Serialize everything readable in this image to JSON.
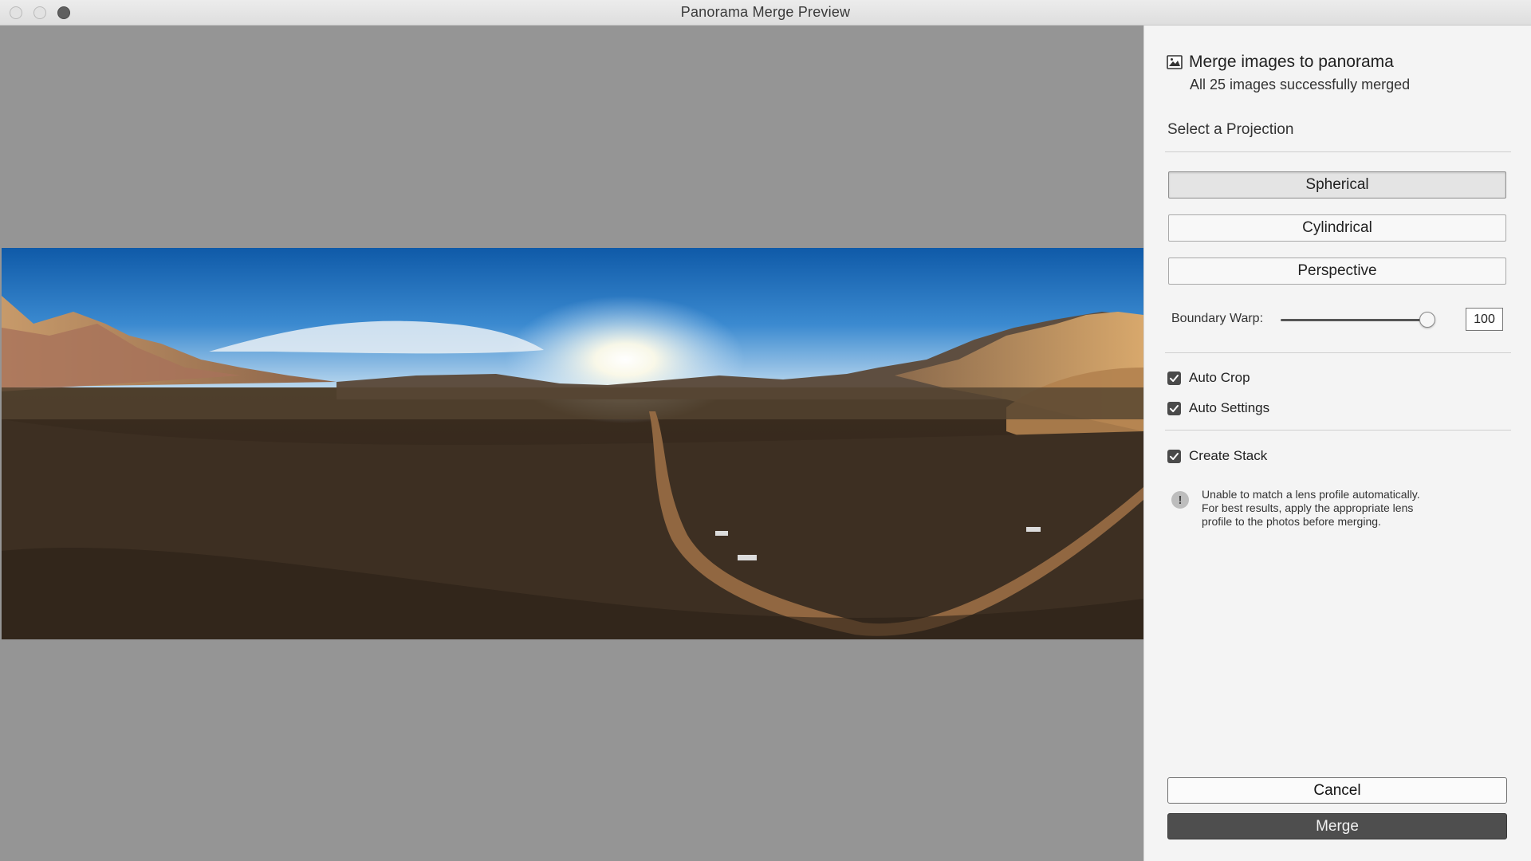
{
  "window": {
    "title": "Panorama Merge Preview"
  },
  "preview": {
    "background": "#959595"
  },
  "side": {
    "header_title": "Merge images to panorama",
    "header_subtitle": "All 25 images successfully merged",
    "projection_label": "Select a Projection",
    "projections": [
      {
        "label": "Spherical",
        "selected": true
      },
      {
        "label": "Cylindrical",
        "selected": false
      },
      {
        "label": "Perspective",
        "selected": false
      }
    ],
    "boundary_warp": {
      "label": "Boundary Warp:",
      "value": "100",
      "level": 1.0
    },
    "options": [
      {
        "label": "Auto Crop",
        "checked": true
      },
      {
        "label": "Auto Settings",
        "checked": true
      },
      {
        "label": "Create Stack",
        "checked": true
      }
    ],
    "warning_lines": [
      "Unable to match a lens profile automatically.",
      "For best results, apply the appropriate lens",
      "profile to the photos before merging."
    ],
    "cancel_label": "Cancel",
    "merge_label": "Merge"
  },
  "colors": {
    "accent_dark": "#4e4e4e",
    "panel_bg": "#f4f4f4"
  },
  "icons": {
    "header": "image-icon",
    "warning": "exclamation-circle-icon",
    "check": "checkmark-icon"
  }
}
